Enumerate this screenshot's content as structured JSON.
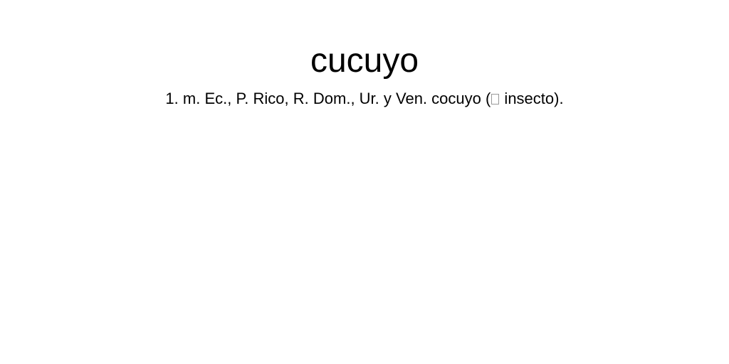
{
  "entry": {
    "headword": "cucuyo",
    "sense_number": "1.",
    "definition_before": "m. Ec., P. Rico, R. Dom., Ur. y Ven. cocuyo (",
    "definition_after": " insecto).",
    "glyph_icon": "missing-glyph-box"
  }
}
